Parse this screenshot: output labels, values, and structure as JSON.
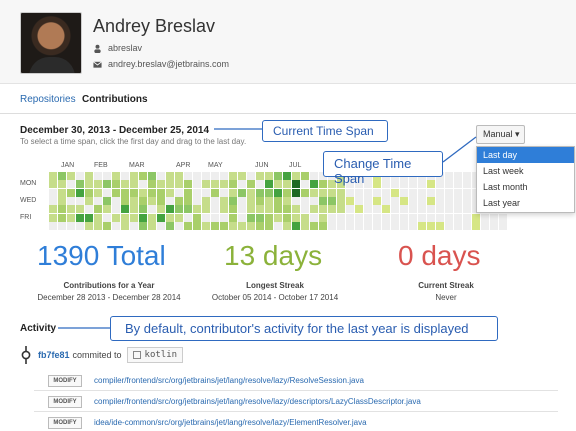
{
  "profile": {
    "name": "Andrey Breslav",
    "username": "abreslav",
    "email": "andrey.breslav@jetbrains.com"
  },
  "tabs": [
    "Repositories",
    "Contributions"
  ],
  "timespan": {
    "range": "December 30, 2013 - December 25, 2014",
    "hint": "To select a time span, click the first day and drag to the last day."
  },
  "callouts": {
    "current": "Current Time Span",
    "change": "Change Time Span",
    "activity": "By default, contributor's activity for the last year is displayed"
  },
  "dropdown": {
    "label": "Manual",
    "options": [
      "Last day",
      "Last week",
      "Last month",
      "Last year"
    ],
    "selected": "Last day"
  },
  "calendar": {
    "months": [
      "JAN",
      "FEB",
      "MAR",
      "APR",
      "MAY",
      "JUN",
      "JUL"
    ],
    "days": [
      "MON",
      "WED",
      "FRI"
    ]
  },
  "stats": [
    {
      "value": "1390 Total",
      "label": "Contributions for a Year",
      "sub": "December 28 2013 - December 28 2014",
      "color": "#2f7ed8"
    },
    {
      "value": "13 days",
      "label": "Longest Streak",
      "sub": "October 05 2014 - October 17 2014",
      "color": "#8bb23a"
    },
    {
      "value": "0 days",
      "label": "Current Streak",
      "sub": "Never",
      "color": "#d9534f"
    }
  ],
  "activity": {
    "title": "Activity",
    "commit_hash": "fb7fe81",
    "commit_text": "commited to",
    "repo": "kotlin",
    "files": [
      {
        "action": "MODIFY",
        "path": "compiler/frontend/src/org/jetbrains/jet/lang/resolve/lazy/ResolveSession.java"
      },
      {
        "action": "MODIFY",
        "path": "compiler/frontend/src/org/jetbrains/jet/lang/resolve/lazy/descriptors/LazyClassDescriptor.java"
      },
      {
        "action": "MODIFY",
        "path": "idea/ide-common/src/org/jetbrains/jet/lang/resolve/lazy/ElementResolver.java"
      }
    ]
  }
}
